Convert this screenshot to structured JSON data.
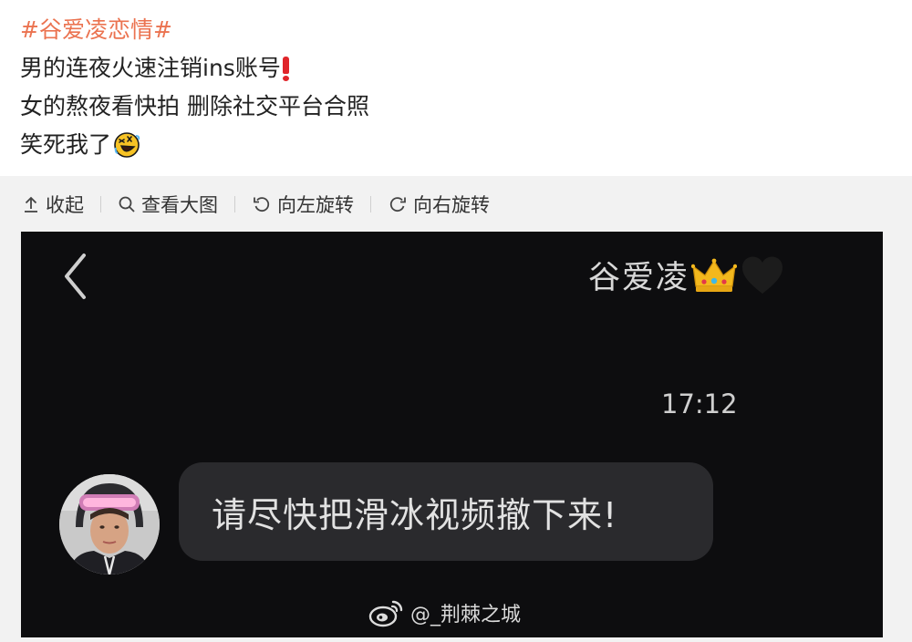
{
  "post": {
    "hashtag": "#谷爱凌恋情#",
    "line1": "男的连夜火速注销ins账号",
    "line1_emoji": "red-exclamation-icon",
    "line2": "女的熬夜看快拍 删除社交平台合照",
    "line3": "笑死我了",
    "line3_emoji": "rolling-laughing-emoji"
  },
  "toolbar": {
    "collapse": "收起",
    "view_large": "查看大图",
    "rotate_left": "向左旋转",
    "rotate_right": "向右旋转"
  },
  "chat": {
    "title": "谷爱凌",
    "title_icons": [
      "crown-icon",
      "black-heart-icon"
    ],
    "timestamp": "17:12",
    "message": "请尽快把滑冰视频撤下来!",
    "watermark": "@_荆棘之城"
  },
  "colors": {
    "hashtag": "#eb7350",
    "chat_background": "#0d0d0f",
    "bubble": "#2a2a2d",
    "toolbar_background": "#f2f2f2"
  }
}
